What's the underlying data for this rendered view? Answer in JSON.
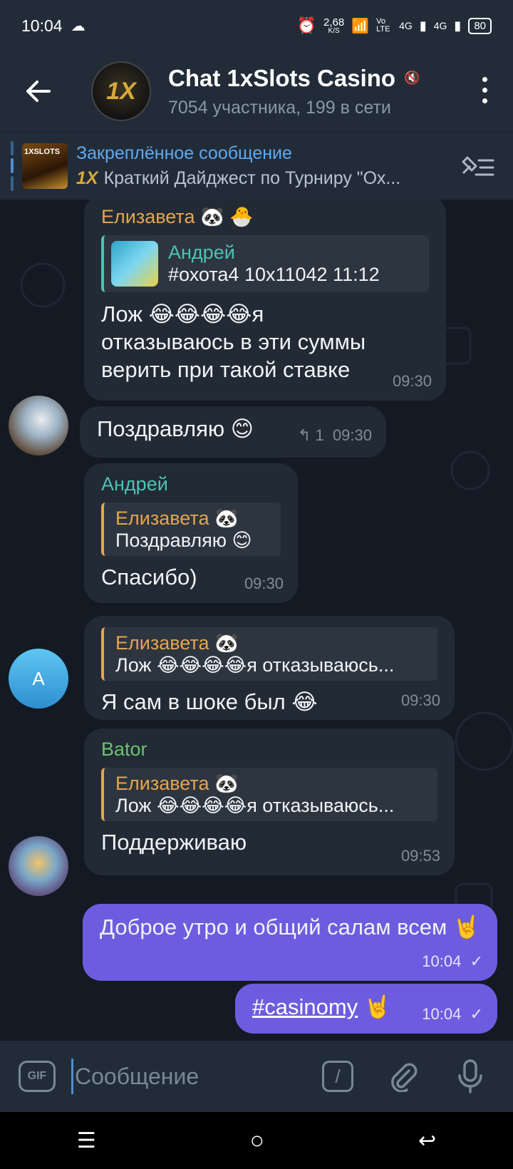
{
  "status_bar": {
    "time": "10:04",
    "speed": "2,68",
    "speed_unit": "K/S",
    "volte": "Vo LTE",
    "net1": "4G",
    "net2": "4G",
    "battery": "80"
  },
  "header": {
    "avatar_text": "1X",
    "title": "Chat 1xSlots Casino",
    "subtitle": "7054 участника, 199 в сети"
  },
  "pinned": {
    "title": "Закреплённое сообщение",
    "brand": "1X",
    "preview": "Краткий Дайджест по Турниру \"Ох..."
  },
  "messages": [
    {
      "author": "Елизавета 🐼 🐣",
      "reply_author": "Андрей",
      "reply_text": "#охота4 10x11042 11:12",
      "text": "Лож 😂😂😂😂я отказываюсь в эти суммы верить при такой ставке",
      "time": "09:30"
    },
    {
      "text": "Поздравляю 😊",
      "reply_count": "↰ 1",
      "time": "09:30"
    },
    {
      "author": "Андрей",
      "reply_author": "Елизавета 🐼",
      "reply_text": "Поздравляю 😊",
      "text": "Спасибо)",
      "time": "09:30"
    },
    {
      "avatar_letter": "A",
      "reply_author": "Елизавета 🐼",
      "reply_text": "Лож 😂😂😂😂я отказываюсь...",
      "text": "Я сам в шоке был 😂",
      "time": "09:30"
    },
    {
      "author": "Bator",
      "reply_author": "Елизавета 🐼",
      "reply_text": "Лож 😂😂😂😂я отказываюсь...",
      "text": "Поддерживаю",
      "time": "09:53"
    },
    {
      "text": "Доброе утро и общий салам всем 🤘",
      "time": "10:04",
      "status": "✓"
    },
    {
      "text": "#casinomy",
      "emoji": "🤘",
      "time": "10:04",
      "status": "✓"
    }
  ],
  "input": {
    "gif_label": "GIF",
    "placeholder": "Сообщение",
    "command_label": "/"
  },
  "colors": {
    "accent": "#5fa9ef",
    "outgoing": "#6e5ce0",
    "incoming": "#222a35",
    "author_orange": "#e5a550",
    "author_teal": "#4bc3b4",
    "author_green": "#6bc46d"
  }
}
